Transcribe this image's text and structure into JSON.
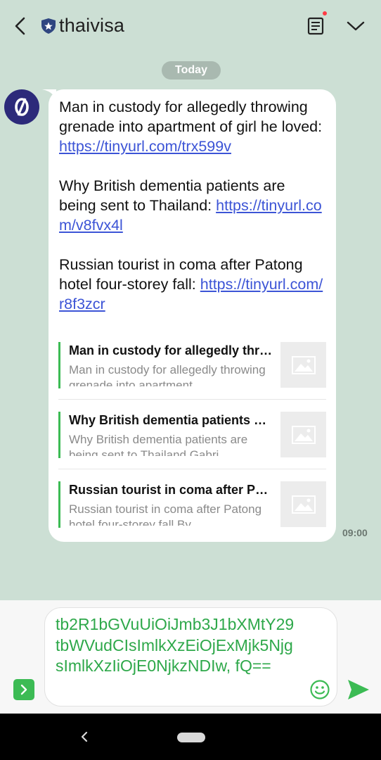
{
  "header": {
    "title": "thaivisa",
    "back_icon": "chevron-left-icon",
    "notes_icon": "notes-icon",
    "menu_icon": "chevron-down-icon"
  },
  "chat": {
    "date_label": "Today",
    "message": {
      "paragraphs": [
        {
          "text": "Man in custody for allegedly throwing grenade into apartment of girl he loved: ",
          "link": "https://tinyurl.com/trx599v"
        },
        {
          "text": "Why British dementia patients are being sent to Thailand: ",
          "link": "https://tinyurl.com/v8fvx4l"
        },
        {
          "text": "Russian tourist in coma after Patong hotel four-storey fall: ",
          "link": "https://tinyurl.com/r8f3zcr"
        }
      ],
      "previews": [
        {
          "title": "Man in custody for allegedly throwing grenade into apartment of girl he loved",
          "description": "Man in custody for allegedly throwing grenade into apartment"
        },
        {
          "title": "Why British dementia patients are being sent to Thailand",
          "description": "Why British dementia patients are being sent to Thailand Gabri"
        },
        {
          "title": "Russian tourist in coma after Patong hotel four-storey fall",
          "description": "Russian tourist in coma after Patong hotel four-storey fall By"
        }
      ],
      "time": "09:00"
    }
  },
  "composer": {
    "value": "tb2R1bGVuUiOiJmb3J1bXMtY29tbWVudCIsImlkXzEiOjExMjk5NjgsImlkXzIiOjE0NjkzNDIw, fQ=="
  },
  "colors": {
    "accent": "#3cbb54",
    "link": "#3c54d6",
    "background": "#ccdfd4"
  }
}
